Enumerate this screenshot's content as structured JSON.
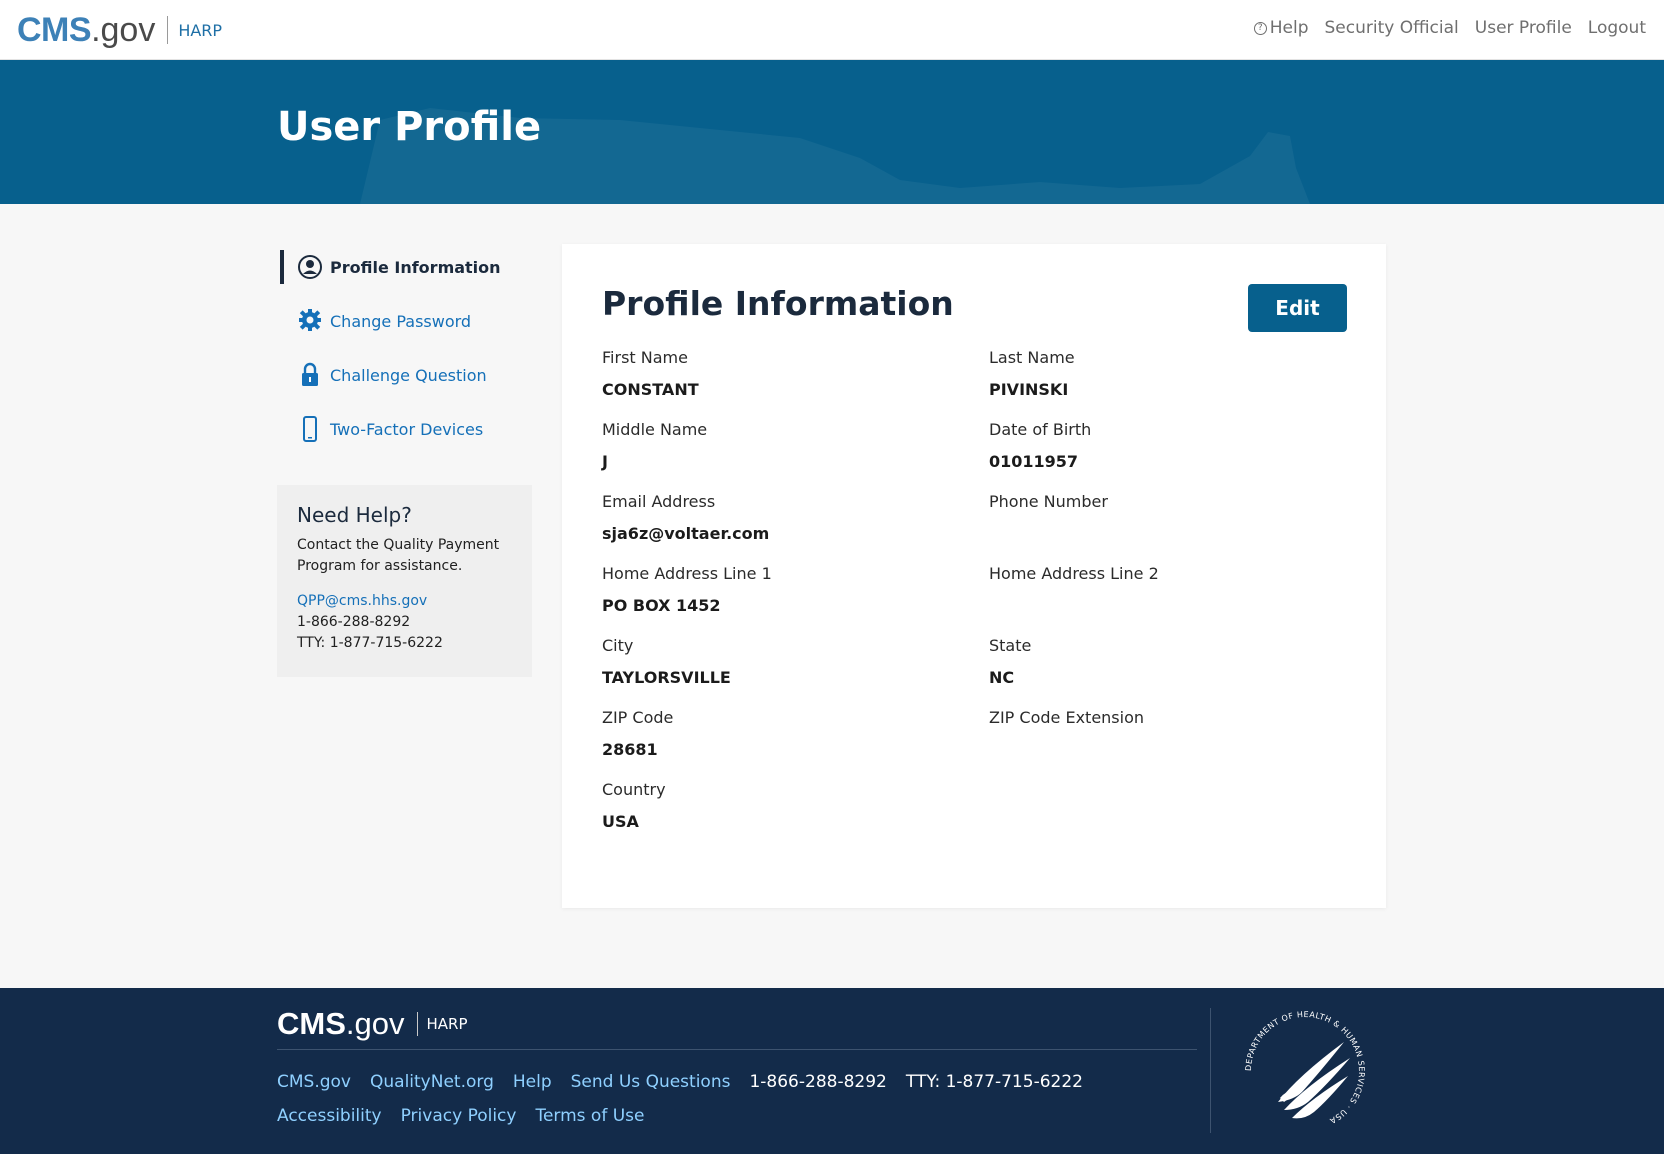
{
  "header": {
    "brand_cms": "CMS",
    "brand_gov": ".gov",
    "brand_app": "HARP",
    "nav": {
      "help": "Help",
      "security_official": "Security Official",
      "user_profile": "User Profile",
      "logout": "Logout"
    }
  },
  "banner": {
    "title": "User Profile"
  },
  "sidenav": {
    "items": [
      {
        "label": "Profile Information",
        "icon": "user-circle-icon",
        "active": true
      },
      {
        "label": "Change Password",
        "icon": "gear-icon",
        "active": false
      },
      {
        "label": "Challenge Question",
        "icon": "lock-icon",
        "active": false
      },
      {
        "label": "Two-Factor Devices",
        "icon": "mobile-phone-icon",
        "active": false
      }
    ]
  },
  "help_box": {
    "title": "Need Help?",
    "text": "Contact the Quality Payment Program for assistance.",
    "email": "QPP@cms.hhs.gov",
    "phone": "1-866-288-8292",
    "tty": "TTY: 1-877-715-6222"
  },
  "profile": {
    "title": "Profile Information",
    "edit_label": "Edit",
    "fields": [
      {
        "label": "First Name",
        "value": "CONSTANT"
      },
      {
        "label": "Last Name",
        "value": "PIVINSKI"
      },
      {
        "label": "Middle Name",
        "value": "J"
      },
      {
        "label": "Date of Birth",
        "value": "01011957"
      },
      {
        "label": "Email Address",
        "value": "sja6z@voltaer.com"
      },
      {
        "label": "Phone Number",
        "value": ""
      },
      {
        "label": "Home Address Line 1",
        "value": "PO BOX 1452"
      },
      {
        "label": "Home Address Line 2",
        "value": ""
      },
      {
        "label": "City",
        "value": "TAYLORSVILLE"
      },
      {
        "label": "State",
        "value": "NC"
      },
      {
        "label": "ZIP Code",
        "value": "28681"
      },
      {
        "label": "ZIP Code Extension",
        "value": ""
      },
      {
        "label": "Country",
        "value": "USA"
      }
    ]
  },
  "footer": {
    "brand_cms": "CMS",
    "brand_gov": ".gov",
    "brand_app": "HARP",
    "links_row1": [
      "CMS.gov",
      "QualityNet.org",
      "Help",
      "Send Us Questions"
    ],
    "phone": "1-866-288-8292",
    "tty": "TTY: 1-877-715-6222",
    "links_row2": [
      "Accessibility",
      "Privacy Policy",
      "Terms of Use"
    ],
    "seal_text": "DEPARTMENT OF HEALTH & HUMAN SERVICES · USA"
  },
  "colors": {
    "brand_blue": "#07608d",
    "link_blue": "#1570b8",
    "footer_navy": "#132b4a",
    "heading_navy": "#1b2a3d"
  }
}
